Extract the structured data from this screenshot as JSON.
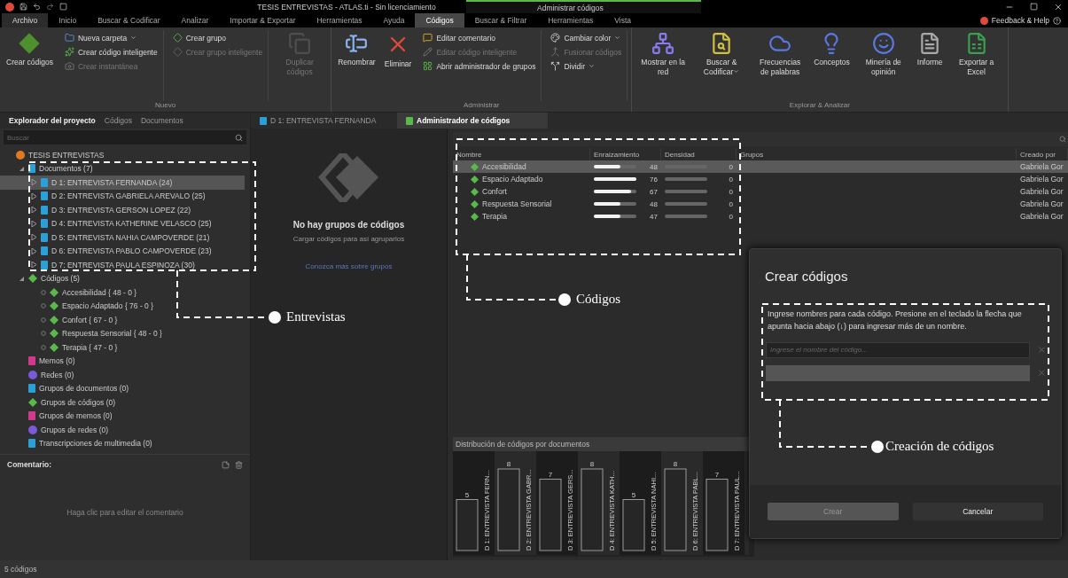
{
  "window": {
    "title": "TESIS ENTREVISTAS - ATLAS.ti - Sin licenciamiento",
    "context_title": "Administrar códigos"
  },
  "menu_tabs": [
    {
      "label": "Archivo",
      "kind": "file",
      "selected": false
    },
    {
      "label": "Inicio",
      "kind": "tab",
      "selected": false
    },
    {
      "label": "Buscar & Codificar",
      "kind": "tab",
      "selected": false
    },
    {
      "label": "Analizar",
      "kind": "tab",
      "selected": false
    },
    {
      "label": "Importar & Exportar",
      "kind": "tab",
      "selected": false
    },
    {
      "label": "Herramientas",
      "kind": "tab",
      "selected": false
    },
    {
      "label": "Ayuda",
      "kind": "tab",
      "selected": false
    },
    {
      "label": "Códigos",
      "kind": "tab",
      "selected": true
    },
    {
      "label": "Buscar & Filtrar",
      "kind": "tab",
      "selected": false
    },
    {
      "label": "Herramientas",
      "kind": "tab",
      "selected": false
    },
    {
      "label": "Vista",
      "kind": "tab",
      "selected": false
    }
  ],
  "help": {
    "label": "Feedback & Help"
  },
  "ribbon": [
    {
      "label": "Nuevo",
      "items": [
        {
          "kind": "large",
          "label": "Crear códigos",
          "disabled": false,
          "dropdown": false
        },
        {
          "kind": "stack",
          "items": [
            {
              "label": "Nueva carpeta",
              "disabled": false,
              "dropdown": true
            },
            {
              "label": "Crear código inteligente",
              "disabled": false,
              "dropdown": false
            },
            {
              "label": "Crear instantánea",
              "disabled": true,
              "dropdown": false
            }
          ]
        },
        {
          "kind": "stack",
          "items": [
            {
              "label": "Crear grupo",
              "disabled": false,
              "dropdown": false
            },
            {
              "label": "Crear grupo inteligente",
              "disabled": true,
              "dropdown": false
            }
          ]
        },
        {
          "kind": "large",
          "label": "Duplicar códigos",
          "disabled": true,
          "dropdown": false
        }
      ]
    },
    {
      "label": "Administrar",
      "items": [
        {
          "kind": "large",
          "label": "Renombrar",
          "disabled": false,
          "dropdown": false
        },
        {
          "kind": "large",
          "label": "Eliminar",
          "disabled": false,
          "dropdown": false
        },
        {
          "kind": "stack",
          "items": [
            {
              "label": "Editar comentario",
              "disabled": false,
              "dropdown": false
            },
            {
              "label": "Editar código inteligente",
              "disabled": true,
              "dropdown": false
            },
            {
              "label": "Abrir administrador de grupos",
              "disabled": false,
              "dropdown": false
            }
          ]
        },
        {
          "kind": "stack",
          "items": [
            {
              "label": "Cambiar color",
              "disabled": false,
              "dropdown": true
            },
            {
              "label": "Fusionar códigos",
              "disabled": true,
              "dropdown": false
            },
            {
              "label": "Dividir",
              "disabled": false,
              "dropdown": true
            }
          ]
        }
      ]
    },
    {
      "label": "Explorar & Analizar",
      "items": [
        {
          "kind": "large",
          "label": "Mostrar en la red",
          "disabled": false,
          "dropdown": false
        },
        {
          "kind": "large",
          "label": "Buscar & Codificar",
          "disabled": false,
          "dropdown": true
        },
        {
          "kind": "large",
          "label": "Frecuencias de palabras",
          "disabled": false,
          "dropdown": false
        },
        {
          "kind": "large",
          "label": "Conceptos",
          "disabled": false,
          "dropdown": false
        },
        {
          "kind": "large",
          "label": "Minería de opinión",
          "disabled": false,
          "dropdown": false
        },
        {
          "kind": "large",
          "label": "Informe",
          "disabled": false,
          "dropdown": false
        },
        {
          "kind": "large",
          "label": "Exportar a Excel",
          "disabled": false,
          "dropdown": false
        }
      ]
    }
  ],
  "explorer": {
    "tabs": [
      {
        "label": "Explorador del proyecto",
        "selected": true
      },
      {
        "label": "Códigos",
        "selected": false
      },
      {
        "label": "Documentos",
        "selected": false
      }
    ],
    "search": {
      "placeholder": "Buscar"
    },
    "tree": {
      "label": "TESIS ENTREVISTAS",
      "kind": "project",
      "selected": false,
      "children": [
        {
          "label": "Documentos (7)",
          "kind": "documents",
          "selected": false,
          "expanded": true,
          "children": [
            {
              "label": "D 1: ENTREVISTA FERNANDA (24)",
              "kind": "document",
              "selected": true,
              "expanded": false
            },
            {
              "label": "D 2: ENTREVISTA GABRIELA AREVALO (25)",
              "kind": "document",
              "selected": false,
              "expanded": false
            },
            {
              "label": "D 3: ENTREVISTA GERSON LOPEZ (22)",
              "kind": "document",
              "selected": false,
              "expanded": false
            },
            {
              "label": "D 4: ENTREVISTA KATHERINE VELASCO (25)",
              "kind": "document",
              "selected": false,
              "expanded": false
            },
            {
              "label": "D 5: ENTREVISTA NAHIA CAMPOVERDE (21)",
              "kind": "document",
              "selected": false,
              "expanded": false
            },
            {
              "label": "D 6: ENTREVISTA PABLO CAMPOVERDE (23)",
              "kind": "document",
              "selected": false,
              "expanded": false
            },
            {
              "label": "D 7: ENTREVISTA PAULA ESPINOZA (30)",
              "kind": "document",
              "selected": false,
              "expanded": false
            }
          ]
        },
        {
          "label": "Códigos (5)",
          "kind": "codes",
          "selected": false,
          "expanded": true,
          "children": [
            {
              "label": "Accesibilidad { 48 - 0 }",
              "kind": "code",
              "selected": false
            },
            {
              "label": "Espacio Adaptado { 76 - 0 }",
              "kind": "code",
              "selected": false
            },
            {
              "label": "Confort { 67 - 0 }",
              "kind": "code",
              "selected": false
            },
            {
              "label": "Respuesta Sensorial { 48 - 0 }",
              "kind": "code",
              "selected": false
            },
            {
              "label": "Terapia { 47 - 0 }",
              "kind": "code",
              "selected": false
            }
          ]
        },
        {
          "label": "Memos (0)",
          "kind": "memos",
          "selected": false
        },
        {
          "label": "Redes (0)",
          "kind": "networks",
          "selected": false
        },
        {
          "label": "Grupos de documentos (0)",
          "kind": "docgroups",
          "selected": false
        },
        {
          "label": "Grupos de códigos (0)",
          "kind": "codegroups",
          "selected": false
        },
        {
          "label": "Grupos de memos (0)",
          "kind": "memogroups",
          "selected": false
        },
        {
          "label": "Grupos de redes (0)",
          "kind": "netgroups",
          "selected": false
        },
        {
          "label": "Transcripciones de multimedia (0)",
          "kind": "transcripts",
          "selected": false
        }
      ]
    },
    "comment": {
      "title": "Comentario:",
      "placeholder": "Haga clic para editar el comentario"
    }
  },
  "doc_tabs": [
    {
      "label": "D 1: ENTREVISTA FERNANDA",
      "selected": false
    },
    {
      "label": "Administrador de códigos",
      "selected": true
    }
  ],
  "groups_pane": {
    "title": "No hay grupos de códigos",
    "subtitle": "Cargar códigos para así agruparlos",
    "link": "Conozca más sobre grupos"
  },
  "code_table": {
    "columns": [
      "Nombre",
      "Enraizamiento",
      "Densidad",
      "Grupos",
      "Creado por"
    ],
    "rows": [
      {
        "name": "Accesibilidad",
        "grounded": "48",
        "level": 0.63,
        "density": "0",
        "created_by": "Gabriela Gor",
        "selected": true
      },
      {
        "name": "Espacio Adaptado",
        "grounded": "76",
        "level": 1,
        "density": "0",
        "created_by": "Gabriela Gor",
        "selected": false
      },
      {
        "name": "Confort",
        "grounded": "67",
        "level": 0.88,
        "density": "0",
        "created_by": "Gabriela Gor",
        "selected": false
      },
      {
        "name": "Respuesta Sensorial",
        "grounded": "48",
        "level": 0.63,
        "density": "0",
        "created_by": "Gabriela Gor",
        "selected": false
      },
      {
        "name": "Terapia",
        "grounded": "47",
        "level": 0.62,
        "density": "0",
        "created_by": "Gabriela Gor",
        "selected": false
      }
    ]
  },
  "distribution": {
    "title": "Distribución de códigos por documentos",
    "chart_data": {
      "type": "bar",
      "categories": [
        "D 1: ENTREVISTA FERN...",
        "D 2: ENTREVISTA GABR...",
        "D 3: ENTREVISTA GERS...",
        "D 4: ENTREVISTA KATH...",
        "D 5: ENTREVISTA NAHI...",
        "D 6: ENTREVISTA PABL...",
        "D 7: ENTREVISTA PAUL..."
      ],
      "values": [
        5,
        8,
        7,
        8,
        5,
        8,
        7
      ],
      "data_labels": true
    }
  },
  "dialog": {
    "title": "Crear códigos",
    "instructions": "Ingrese nombres para cada código. Presione en el teclado la flecha que apunta hacia abajo (↓) para ingresar más de un nombre.",
    "fields": [
      {
        "placeholder": "Ingrese el nombre del código...",
        "active": true
      },
      {
        "active": false
      }
    ],
    "buttons": [
      {
        "label": "Crear",
        "disabled": true
      },
      {
        "label": "Cancelar",
        "disabled": false
      }
    ]
  },
  "annotations": [
    {
      "label": "Entrevistas"
    },
    {
      "label": "Códigos"
    },
    {
      "label": "Creación de códigos"
    }
  ],
  "status_bar": "5 códigos"
}
